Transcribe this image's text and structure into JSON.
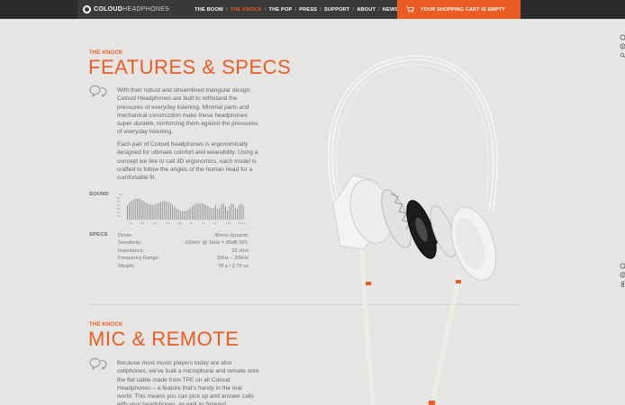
{
  "brand": {
    "name_bold": "COLOUD",
    "name_light": "HEADPHONES"
  },
  "nav": {
    "items": [
      {
        "label": "THE BOOM",
        "active": false
      },
      {
        "label": "THE KNOCK",
        "active": true
      },
      {
        "label": "THE POP",
        "active": false
      },
      {
        "label": "PRESS",
        "active": false
      },
      {
        "label": "SUPPORT",
        "active": false
      },
      {
        "label": "ABOUT",
        "active": false
      },
      {
        "label": "NEWS",
        "active": false
      }
    ]
  },
  "cart": {
    "label": "YOUR SHOPPING CART IS EMPTY",
    "icon": "cart-icon"
  },
  "features": {
    "kicker": "THE KNOCK",
    "title": "FEATURES & SPECS",
    "icon": "speech-bubble-icon",
    "paragraph1": "With their robust and streamlined triangular design, Coloud Headphones are built to withstand the pressures of everyday listening. Minimal parts and mechanical construction make these headphones super durable, reinforcing them against the pressures of everyday listening.",
    "paragraph2": "Each pair of Coloud headphones is ergonomically designed for ultimate comfort and wearability. Using a concept we like to call 3D ergonomics, each model is crafted to follow the angles of the human head for a comfortable fit."
  },
  "sound": {
    "label": "SOUND",
    "db_ticks": [
      "dB",
      "-10",
      "-20",
      "-30",
      "-40",
      "-50",
      "-60"
    ],
    "freq_ticks": [
      "20",
      "50",
      "100",
      "200",
      "500",
      "1k",
      "2k",
      "5k",
      "10k",
      "20k Hz"
    ]
  },
  "specs": {
    "label": "SPECS",
    "rows": [
      {
        "key": "Driver:",
        "value": "40mm dynamic"
      },
      {
        "key": "Sensitivity:",
        "value": "100mV @ 1kHz = 85dB SPL"
      },
      {
        "key": "Impedance:",
        "value": "32 ohm"
      },
      {
        "key": "Frequency Range:",
        "value": "20Hz – 20kHz"
      },
      {
        "key": "Weight:",
        "value": "78 g / 2.75 oz"
      }
    ]
  },
  "mic": {
    "kicker": "THE KNOCK",
    "title": "MIC & REMOTE",
    "icon": "speech-bubble-icon",
    "paragraph": "Because most music players today are also cellphones, we've built a microphone and remote onto the flat cable made from TPE on all Coloud Headphones – a feature that's handy in the real world. This means you can pick up and answer calls with your headphones, as well as forward"
  },
  "colors": {
    "accent": "#ec5b24",
    "topbar": "#3a3a3a",
    "background": "#e6e5e3"
  },
  "side_icons": [
    "share-icon",
    "facebook-icon",
    "search-icon",
    "share-icon",
    "facebook-icon",
    "pinterest-icon"
  ]
}
